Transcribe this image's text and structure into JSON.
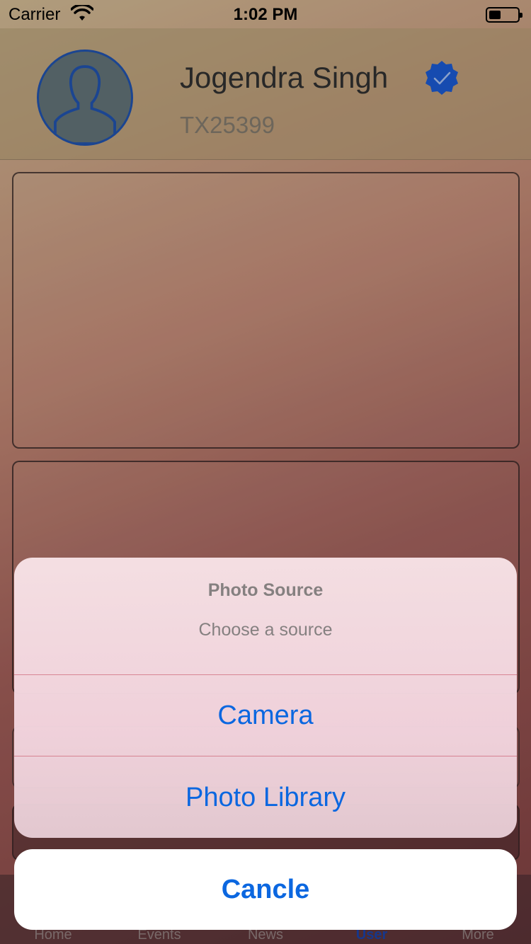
{
  "status_bar": {
    "carrier": "Carrier",
    "time": "1:02 PM",
    "battery_level": 0.4
  },
  "profile": {
    "name": "Jogendra Singh",
    "id": "TX25399",
    "verified": true,
    "verified_color": "#1a56c9"
  },
  "tab_bar": {
    "tabs": [
      {
        "label": "Home"
      },
      {
        "label": "Events"
      },
      {
        "label": "News"
      },
      {
        "label": "User"
      },
      {
        "label": "More"
      }
    ],
    "active_tab": "User"
  },
  "action_sheet": {
    "title": "Photo Source",
    "message": "Choose a source",
    "actions": [
      {
        "label": "Camera"
      },
      {
        "label": "Photo Library"
      }
    ],
    "cancel_label": "Cancle",
    "action_color": "#0b67e0"
  }
}
